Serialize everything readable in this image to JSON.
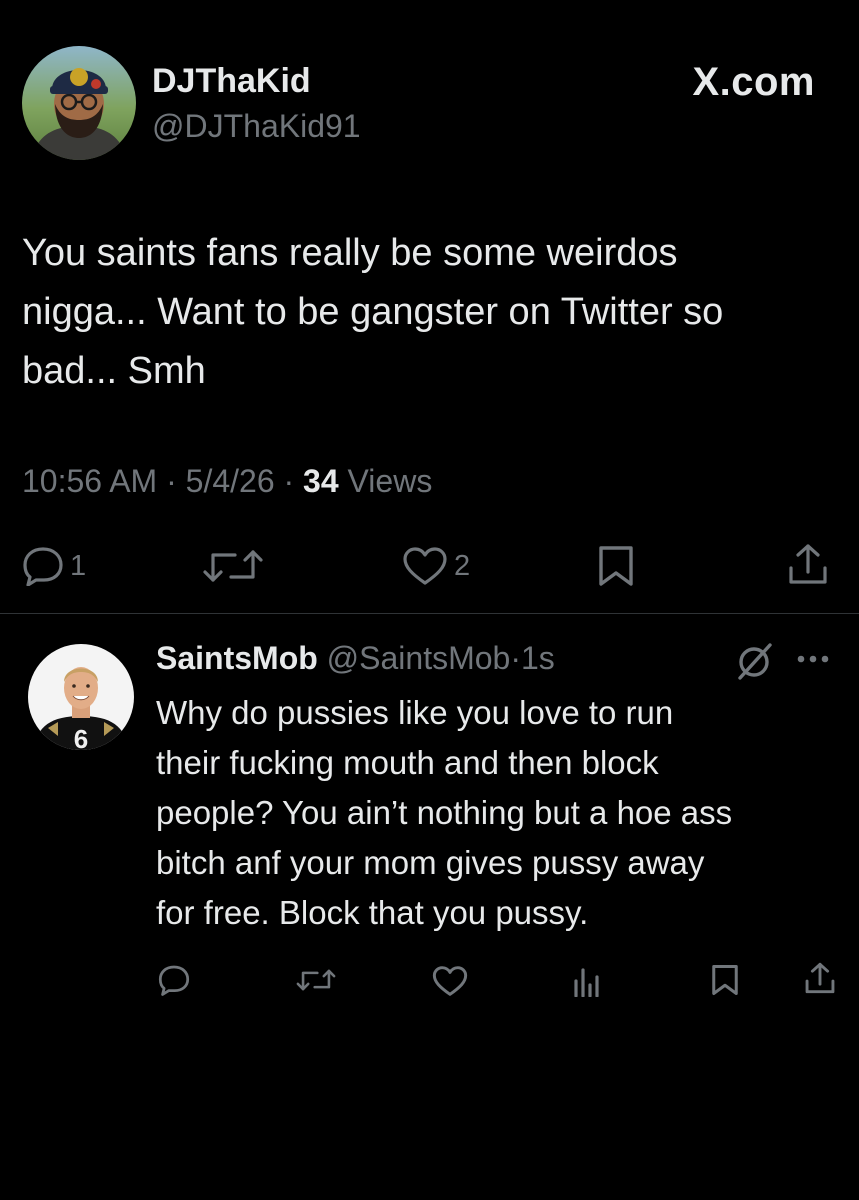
{
  "tweet": {
    "author_name": "DJThaKid",
    "author_handle": "@DJThaKid91",
    "brand": "X.com",
    "text": "You saints fans really be some weirdos\nnigga... Want to be gangster on Twitter so\nbad... Smh",
    "time": "10:56 AM",
    "date": "5/4/26",
    "views_count": "34",
    "views_label": "Views",
    "separator": "·",
    "reply_count": "1",
    "like_count": "2"
  },
  "reply": {
    "author_name": "SaintsMob",
    "author_handle": "@SaintsMob",
    "time": "1s",
    "separator": "·",
    "text": "Why do pussies like you love to run\ntheir fucking mouth and then block\npeople? You ain’t nothing but a hoe ass\nbitch anf your mom gives pussy away\nfor free. Block that you pussy.",
    "jersey_number": "6"
  },
  "icons": {
    "main_actions": [
      "reply-icon",
      "retweet-icon",
      "like-icon",
      "bookmark-icon",
      "share-icon"
    ],
    "reply_actions": [
      "reply-icon",
      "retweet-icon",
      "like-icon",
      "views-icon",
      "bookmark-icon",
      "share-icon"
    ],
    "reply_header": [
      "grok-icon",
      "more-icon"
    ]
  },
  "colors": {
    "background": "#000000",
    "text": "#e7e9ea",
    "secondary": "#71767b",
    "divider": "#2f3336"
  }
}
